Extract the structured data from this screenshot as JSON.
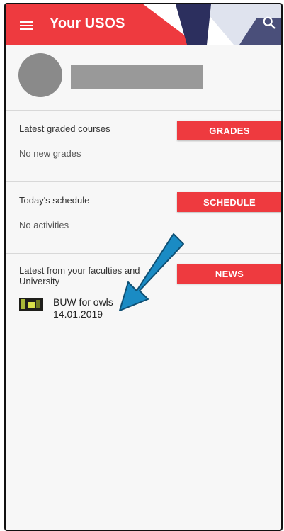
{
  "appbar": {
    "title": "Your USOS",
    "menu_icon": "hamburger-menu-icon",
    "search_icon": "search-icon",
    "colors": {
      "primary": "#ee3a3f",
      "dark": "#2c2f5e"
    }
  },
  "sections": {
    "grades": {
      "title": "Latest graded courses",
      "button": "GRADES",
      "empty": "No new grades"
    },
    "schedule": {
      "title": "Today's schedule",
      "button": "SCHEDULE",
      "empty": "No activities"
    },
    "news": {
      "title": "Latest from your faculties and University",
      "button": "NEWS",
      "items": [
        {
          "title": "BUW for owls",
          "date": "14.01.2019"
        }
      ]
    }
  },
  "annotation": {
    "color": "#1a8bc4",
    "icon": "blue-arrow-icon"
  }
}
